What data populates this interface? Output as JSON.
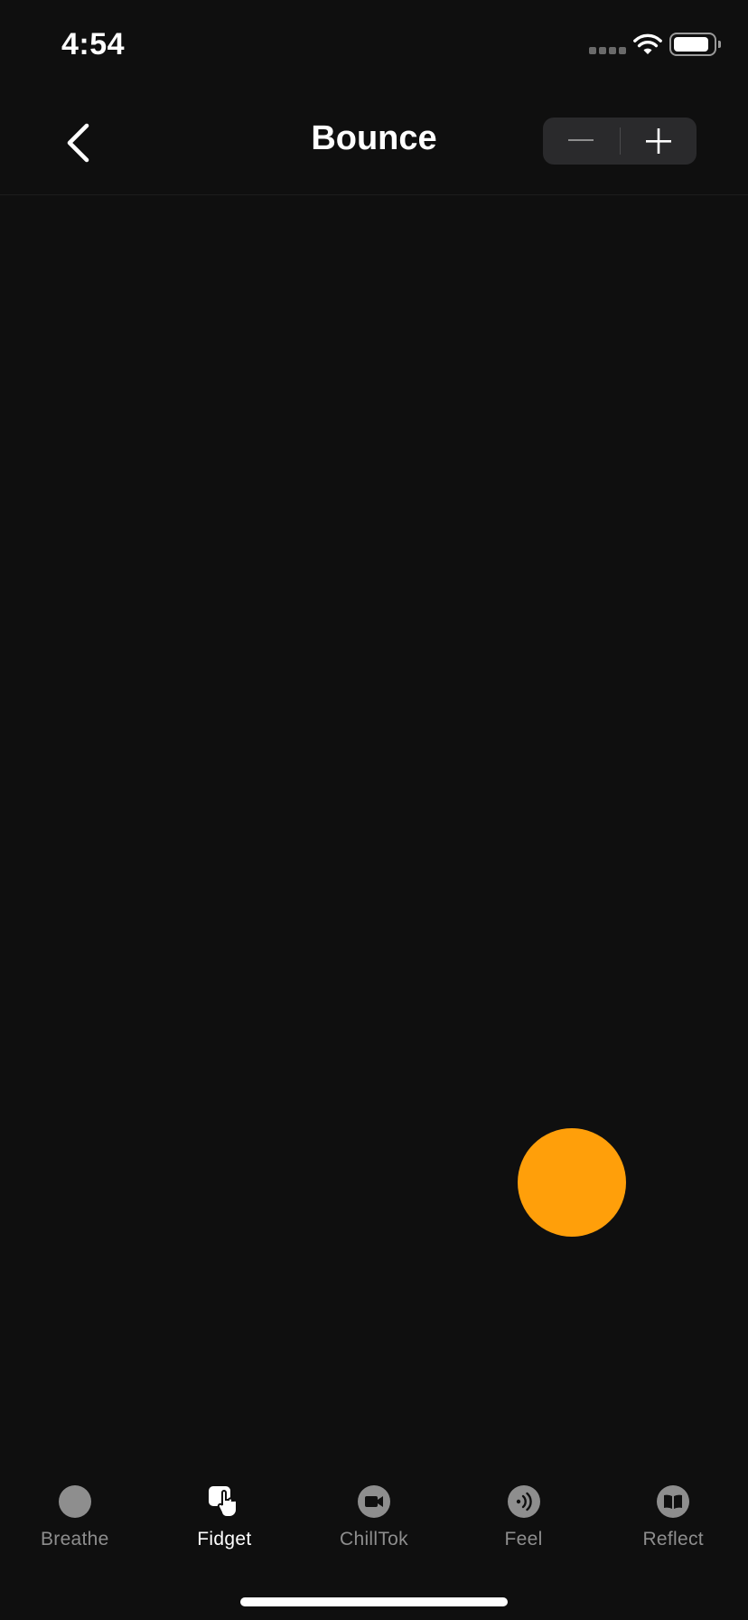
{
  "status_bar": {
    "time": "4:54",
    "icons": [
      "cellular-signal-icon",
      "wifi-icon",
      "battery-icon"
    ]
  },
  "header": {
    "title": "Bounce",
    "back_icon": "chevron-left-icon",
    "stepper": {
      "decrement_icon": "minus-icon",
      "increment_icon": "plus-icon"
    }
  },
  "ball": {
    "color": "#ff9f0a"
  },
  "tabs": [
    {
      "label": "Breathe",
      "icon": "breathe-circle-icon",
      "active": false
    },
    {
      "label": "Fidget",
      "icon": "fidget-hand-icon",
      "active": true
    },
    {
      "label": "ChillTok",
      "icon": "video-camera-icon",
      "active": false
    },
    {
      "label": "Feel",
      "icon": "feel-waves-icon",
      "active": false
    },
    {
      "label": "Reflect",
      "icon": "book-icon",
      "active": false
    }
  ],
  "colors": {
    "background": "#0f0f0f",
    "accent": "#ff9f0a",
    "inactive": "#8e8e8e",
    "active": "#ffffff"
  }
}
